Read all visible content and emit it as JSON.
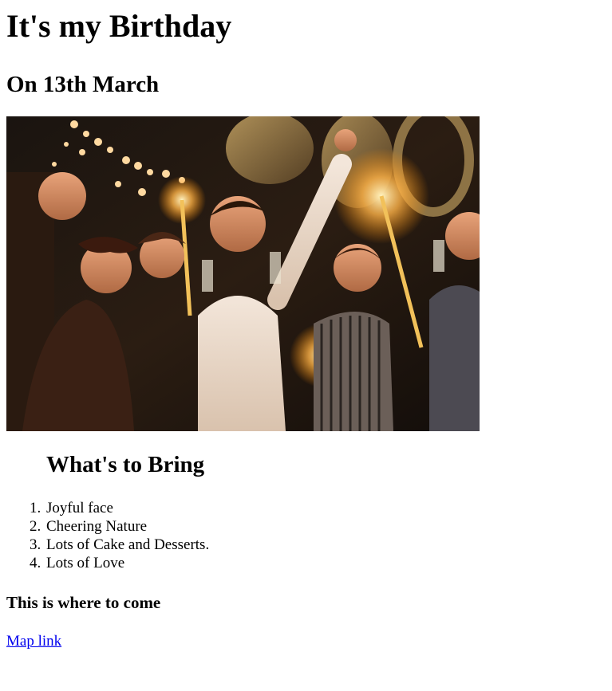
{
  "page": {
    "title": "It's my Birthday",
    "date_heading": "On 13th March",
    "photo_alt": "party-photo",
    "bring_heading": "What's to Bring",
    "bring_items": [
      {
        "num": "1.",
        "text": "Joyful face"
      },
      {
        "num": "2.",
        "text": "Cheering Nature"
      },
      {
        "num": "3.",
        "text": "Lots of Cake and Desserts."
      },
      {
        "num": "4.",
        "text": "Lots of Love"
      }
    ],
    "where_heading": "This is where to come",
    "map_link": "Map link"
  },
  "colors": {
    "link": "#0000ee",
    "text": "#000000",
    "background": "#ffffff"
  }
}
